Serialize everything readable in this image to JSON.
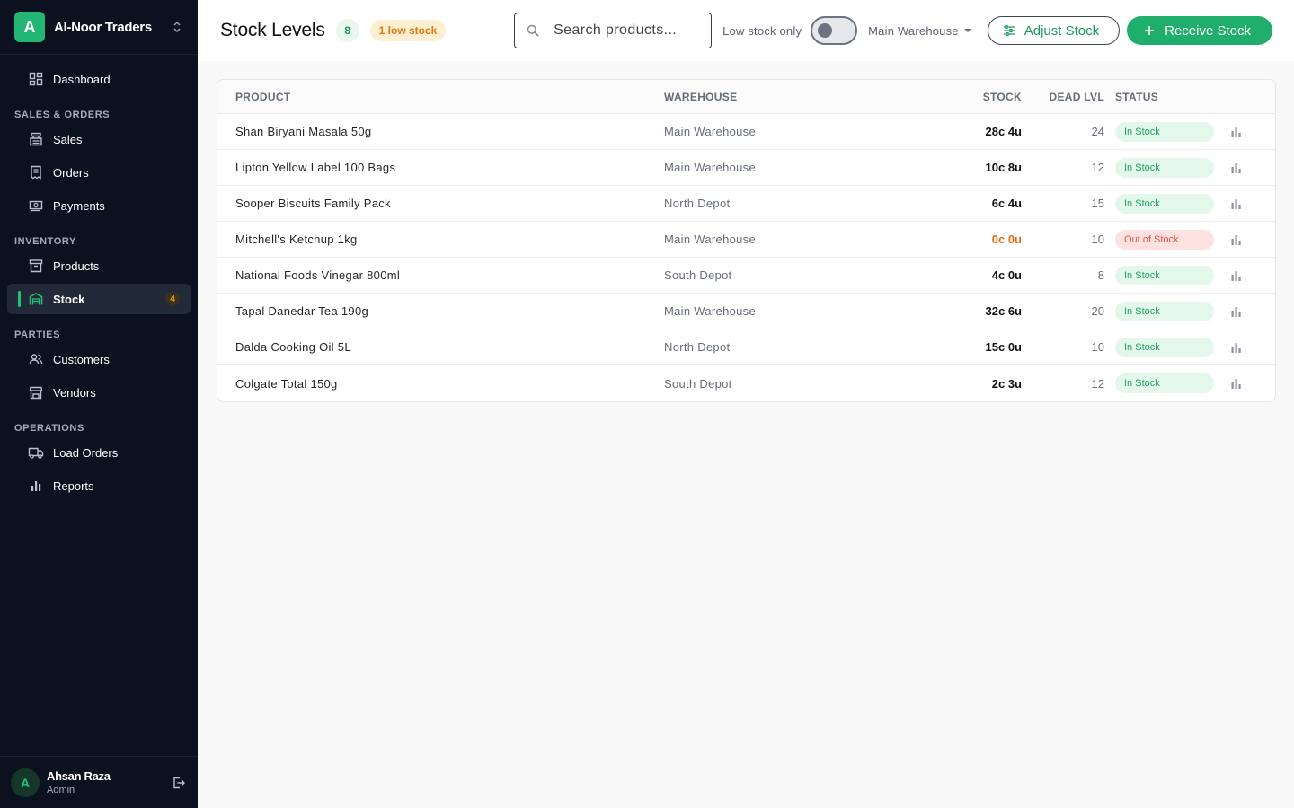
{
  "brand": {
    "initial": "A",
    "name": "Al-Noor Traders"
  },
  "nav": {
    "dashboard": "Dashboard",
    "sec_sales": "SALES & ORDERS",
    "sales": "Sales",
    "orders": "Orders",
    "payments": "Payments",
    "sec_inventory": "INVENTORY",
    "products": "Products",
    "stock": "Stock",
    "stock_badge": "4",
    "sec_parties": "PARTIES",
    "customers": "Customers",
    "vendors": "Vendors",
    "sec_operations": "OPERATIONS",
    "load_orders": "Load Orders",
    "reports": "Reports"
  },
  "user": {
    "initial": "A",
    "name": "Ahsan Raza",
    "role": "Admin"
  },
  "header": {
    "title": "Stock Levels",
    "count": "8",
    "low_badge": "1 low stock",
    "search_placeholder": "Search products...",
    "toggle_label": "Low stock only",
    "warehouse": "Main Warehouse",
    "adjust_label": "Adjust Stock",
    "receive_label": "Receive Stock"
  },
  "table": {
    "columns": {
      "product": "PRODUCT",
      "warehouse": "WAREHOUSE",
      "stock": "STOCK",
      "dead": "DEAD LVL",
      "status": "STATUS"
    },
    "rows": [
      {
        "product": "Shan Biryani Masala 50g",
        "warehouse": "Main Warehouse",
        "stock": "28c 4u",
        "dead": "24",
        "status": "In Stock"
      },
      {
        "product": "Lipton Yellow Label 100 Bags",
        "warehouse": "Main Warehouse",
        "stock": "10c 8u",
        "dead": "12",
        "status": "In Stock"
      },
      {
        "product": "Sooper Biscuits Family Pack",
        "warehouse": "North Depot",
        "stock": "6c 4u",
        "dead": "15",
        "status": "In Stock"
      },
      {
        "product": "Mitchell's Ketchup 1kg",
        "warehouse": "Main Warehouse",
        "stock": "0c 0u",
        "dead": "10",
        "status": "Out of Stock"
      },
      {
        "product": "National Foods Vinegar 800ml",
        "warehouse": "South Depot",
        "stock": "4c 0u",
        "dead": "8",
        "status": "In Stock"
      },
      {
        "product": "Tapal Danedar Tea 190g",
        "warehouse": "Main Warehouse",
        "stock": "32c 6u",
        "dead": "20",
        "status": "In Stock"
      },
      {
        "product": "Dalda Cooking Oil 5L",
        "warehouse": "North Depot",
        "stock": "15c 0u",
        "dead": "10",
        "status": "In Stock"
      },
      {
        "product": "Colgate Total 150g",
        "warehouse": "South Depot",
        "stock": "2c 3u",
        "dead": "12",
        "status": "In Stock"
      }
    ]
  },
  "colors": {
    "accent": "#1fae6c",
    "sidebar": "#0b111e",
    "warning": "#e07a10",
    "danger": "#e5533d"
  }
}
